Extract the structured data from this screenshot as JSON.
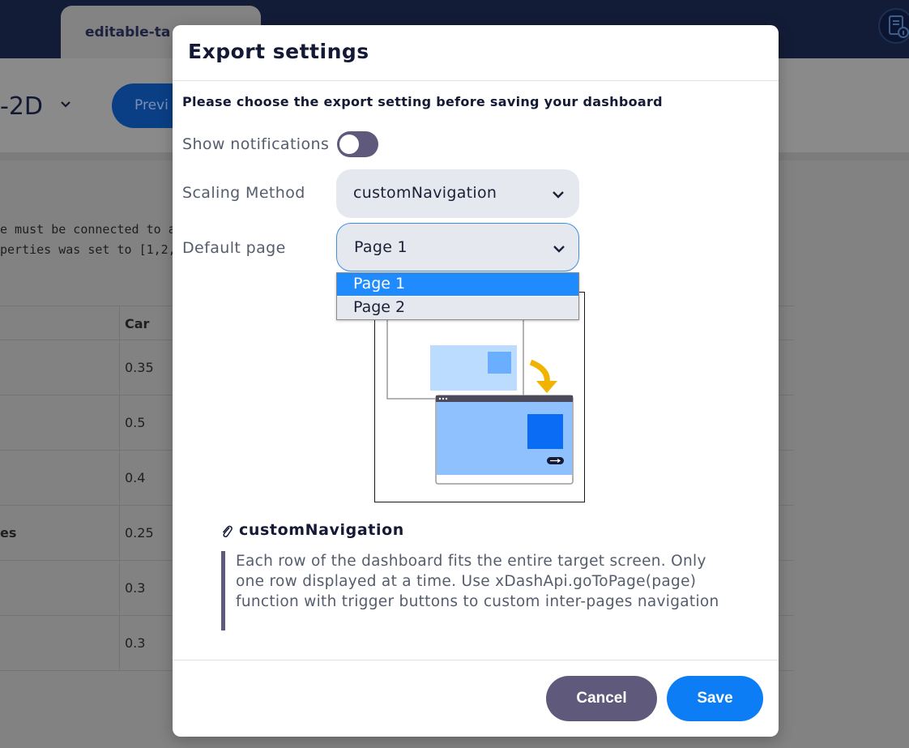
{
  "app": {
    "tab_label": "editable-ta",
    "project_title": "-2D",
    "preview_label": "Previ",
    "description_lines": [
      "e must be connected to a",
      "perties was set to [1,2,"
    ],
    "table": {
      "header": {
        "c0": "",
        "c2": "Car"
      },
      "rows": [
        {
          "c0": "",
          "c2": "0.35"
        },
        {
          "c0": "",
          "c2": "0.5"
        },
        {
          "c0": "",
          "c2": "0.4"
        },
        {
          "c0": "es",
          "c2": "0.25"
        },
        {
          "c0": "",
          "c2": "0.3"
        },
        {
          "c0": "",
          "c2": "0.3"
        }
      ]
    }
  },
  "modal": {
    "title": "Export settings",
    "instruction": "Please choose the export setting before saving your dashboard",
    "show_notifications": {
      "label": "Show notifications",
      "enabled": false
    },
    "scaling_method": {
      "label": "Scaling Method",
      "value": "customNavigation"
    },
    "default_page": {
      "label": "Default page",
      "value": "Page 1",
      "options": [
        "Page 1",
        "Page 2"
      ],
      "selected_index": 0
    },
    "method_name": "customNavigation",
    "method_description": "Each row of the dashboard fits the entire target screen. Only one row displayed at a time. Use xDashApi.goToPage(page) function with trigger buttons to custom inter-pages navigation",
    "buttons": {
      "cancel": "Cancel",
      "save": "Save"
    },
    "colors": {
      "primary": "#0d7df5",
      "secondary": "#5f5a7c",
      "dropdown_highlight": "#1f8bff",
      "illustration_arrow": "#f0b400",
      "illustration_screen": "#8fc1ff",
      "illustration_block": "#0a6cf5"
    }
  }
}
